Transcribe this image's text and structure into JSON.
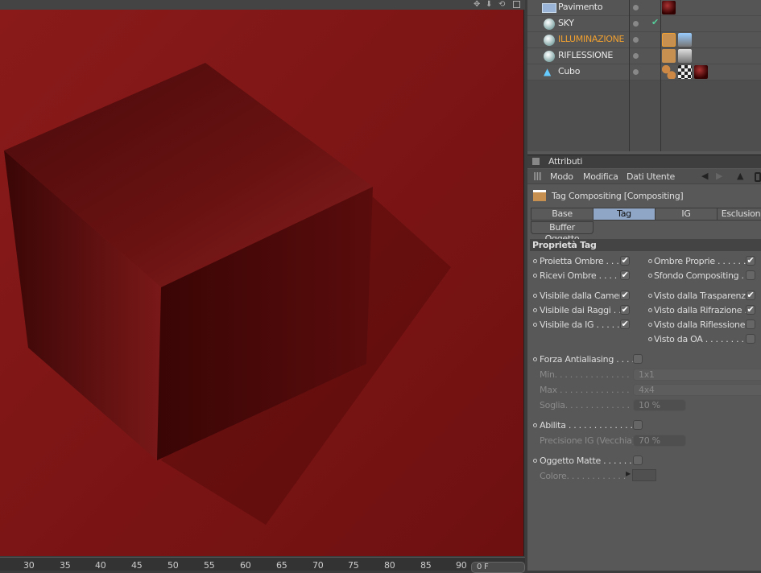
{
  "viewport": {
    "toolbar_icons": [
      "move-icon",
      "down-arrow-icon",
      "rotate-icon",
      "maximize-icon"
    ],
    "render_color": "#7a1414"
  },
  "timeline": {
    "ticks": [
      "30",
      "35",
      "40",
      "45",
      "50",
      "55",
      "60",
      "65",
      "70",
      "75",
      "80",
      "85",
      "90"
    ],
    "frame": "0 F"
  },
  "objects": [
    {
      "name": "Pavimento",
      "icon": "floor-icon",
      "selected": false,
      "tags": [
        "material-icon"
      ]
    },
    {
      "name": "SKY",
      "icon": "sky-icon",
      "selected": false,
      "tags": [],
      "check": "✔"
    },
    {
      "name": "ILLUMINAZIONE",
      "icon": "sky-icon",
      "selected": true,
      "tags": [
        "compositing-tag-icon",
        "sky-material-icon"
      ]
    },
    {
      "name": "RIFLESSIONE",
      "icon": "sky-icon",
      "selected": false,
      "tags": [
        "compositing-tag-icon",
        "sky-material-icon"
      ]
    },
    {
      "name": "Cubo",
      "icon": "cube-icon",
      "selected": false,
      "tags": [
        "phong-tag-icon",
        "texture-tag-icon",
        "material-icon"
      ]
    }
  ],
  "attributes": {
    "header": "Attributi",
    "menu": [
      "Modo",
      "Modifica",
      "Dati Utente"
    ],
    "title": "Tag Compositing [Compositing]",
    "tabs": [
      "Base",
      "Tag",
      "IG",
      "Esclusion"
    ],
    "active_tab": "Tag",
    "tab2": "Buffer Oggetto",
    "section": "Proprietà Tag",
    "left_checks": [
      {
        "label": "Proietta Ombre . . . .",
        "checked": true
      },
      {
        "label": "Ricevi Ombre . . . . .",
        "checked": true
      },
      {
        "label": "Visibile dalla Camera",
        "checked": true
      },
      {
        "label": "Visibile dai Raggi . .",
        "checked": true
      },
      {
        "label": "Visibile da IG . . . . .",
        "checked": true
      }
    ],
    "right_checks": [
      {
        "label": "Ombre Proprie . . . . . . .",
        "checked": true
      },
      {
        "label": "Sfondo Compositing . . .",
        "checked": false
      },
      {
        "label": "Visto dalla Trasparenza",
        "checked": true
      },
      {
        "label": "Visto dalla Rifrazione . .",
        "checked": true
      },
      {
        "label": "Visto dalla Riflessione",
        "checked": false
      },
      {
        "label": "Visto da OA . . . . . . . . .",
        "checked": false
      }
    ],
    "check_glyph": "✔",
    "antialias": {
      "label": "Forza Antialiasing . . . . .",
      "min_label": "Min. . . . . . . . . . . . . . .",
      "min": "1x1",
      "max_label": "Max . . . . . . . . . . . . . .",
      "max": "4x4",
      "soglia_label": "Soglia. . . . . . . . . . . . .",
      "soglia": "10 %"
    },
    "gi": {
      "label": "Abilita . . . . . . . . . . . . .",
      "precision_label": "Precisione IG (Vecchia)",
      "precision": "70 %"
    },
    "matte": {
      "label": "Oggetto Matte . . . . . . .",
      "color_label": "Colore. . . . . . . . . . . ."
    }
  }
}
